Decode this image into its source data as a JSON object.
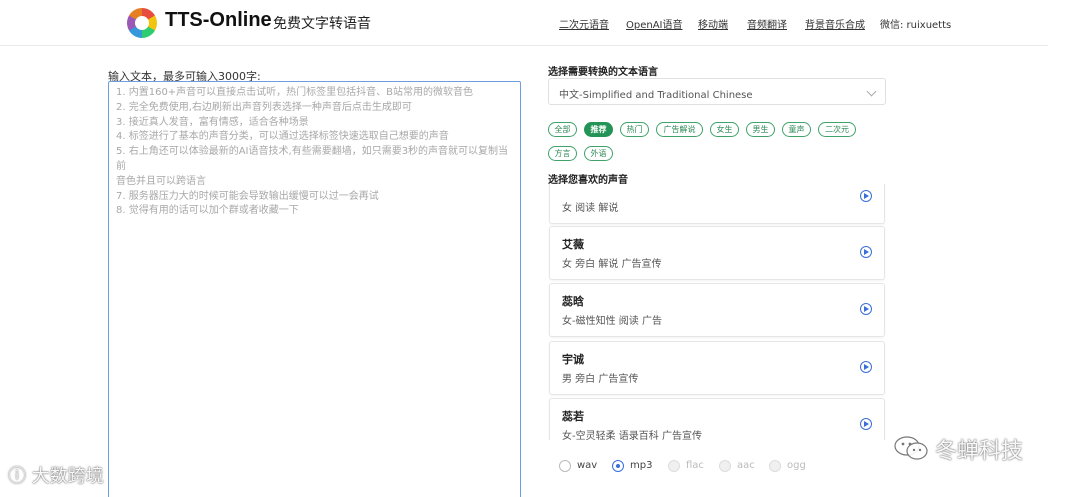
{
  "header": {
    "brand": "TTS-Online",
    "subtitle": "免费文字转语音",
    "nav": [
      "二次元语音",
      "OpenAI语音",
      "移动端",
      "音频翻译",
      "背景音乐合成"
    ],
    "wechat": "微信: ruixuetts"
  },
  "input": {
    "label": "输入文本，最多可输入3000字:",
    "placeholder_lines": [
      "1. 内置160+声音可以直接点击试听，热门标签里包括抖音、B站常用的微软音色",
      "2. 完全免费使用,右边刷新出声音列表选择一种声音后点击生成即可",
      "3. 接近真人发音，富有情感，适合各种场景",
      "4. 标签进行了基本的声音分类，可以通过选择标签快速选取自己想要的声音",
      "5. 右上角还可以体验最新的AI语音技术,有些需要翻墙，如只需要3秒的声音就可以复制当前",
      "音色并且可以跨语言",
      "7. 服务器压力大的时候可能会导致输出缓慢可以过一会再试",
      "8. 觉得有用的话可以加个群或者收藏一下"
    ]
  },
  "language": {
    "title": "选择需要转换的文本语言",
    "selected": "中文-Simplified and Traditional Chinese"
  },
  "tags": [
    "全部",
    "推荐",
    "热门",
    "广告解说",
    "女生",
    "男生",
    "童声",
    "二次元",
    "方言",
    "外语"
  ],
  "voices": {
    "title": "选择您喜欢的声音",
    "items": [
      {
        "name": "",
        "desc": "女 阅读 解说"
      },
      {
        "name": "艾薇",
        "desc": "女 旁白 解说 广告宣传"
      },
      {
        "name": "蕊晗",
        "desc": "女-磁性知性 阅读 广告"
      },
      {
        "name": "宇诚",
        "desc": "男 旁白 广告宣传"
      },
      {
        "name": "蕊若",
        "desc": "女-空灵轻柔 语录百科 广告宣传"
      }
    ]
  },
  "formats": [
    "wav",
    "mp3",
    "flac",
    "aac",
    "ogg"
  ],
  "watermarks": {
    "left": "大数跨境",
    "right": "冬蝉科技"
  }
}
